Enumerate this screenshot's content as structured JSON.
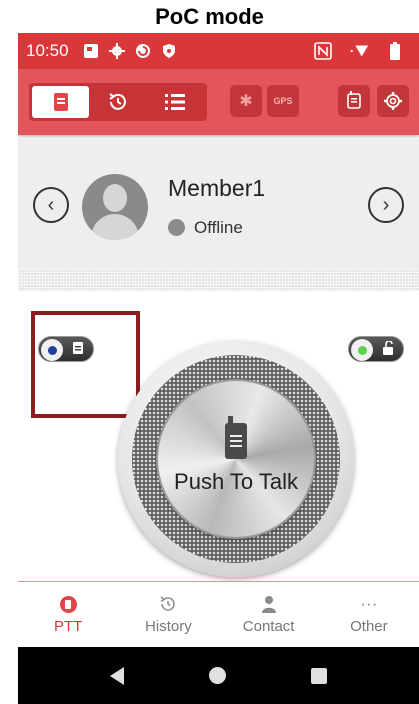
{
  "caption": "PoC mode",
  "status_bar": {
    "time": "10:50",
    "icons": [
      "gallery-icon",
      "settings-icon",
      "sync-icon",
      "shield-icon",
      "nfc-icon",
      "wifi-icon",
      "battery-icon"
    ],
    "nfc_glyph": "N"
  },
  "toolbar": {
    "segments": [
      "ptt-doc-icon",
      "history-icon",
      "list-icon"
    ],
    "bluetooth_glyph": "✱",
    "gps_label": "GPS",
    "accent": "#d9373a"
  },
  "member": {
    "name": "Member1",
    "status": "Offline",
    "status_color": "#8c8c8c",
    "prev_glyph": "‹",
    "next_glyph": "›"
  },
  "ptt": {
    "label": "Push To Talk"
  },
  "bottom_nav": {
    "items": [
      {
        "label": "PTT",
        "active": true
      },
      {
        "label": "History",
        "active": false
      },
      {
        "label": "Contact",
        "active": false
      },
      {
        "label": "Other",
        "active": false
      }
    ],
    "other_glyph": "···"
  }
}
